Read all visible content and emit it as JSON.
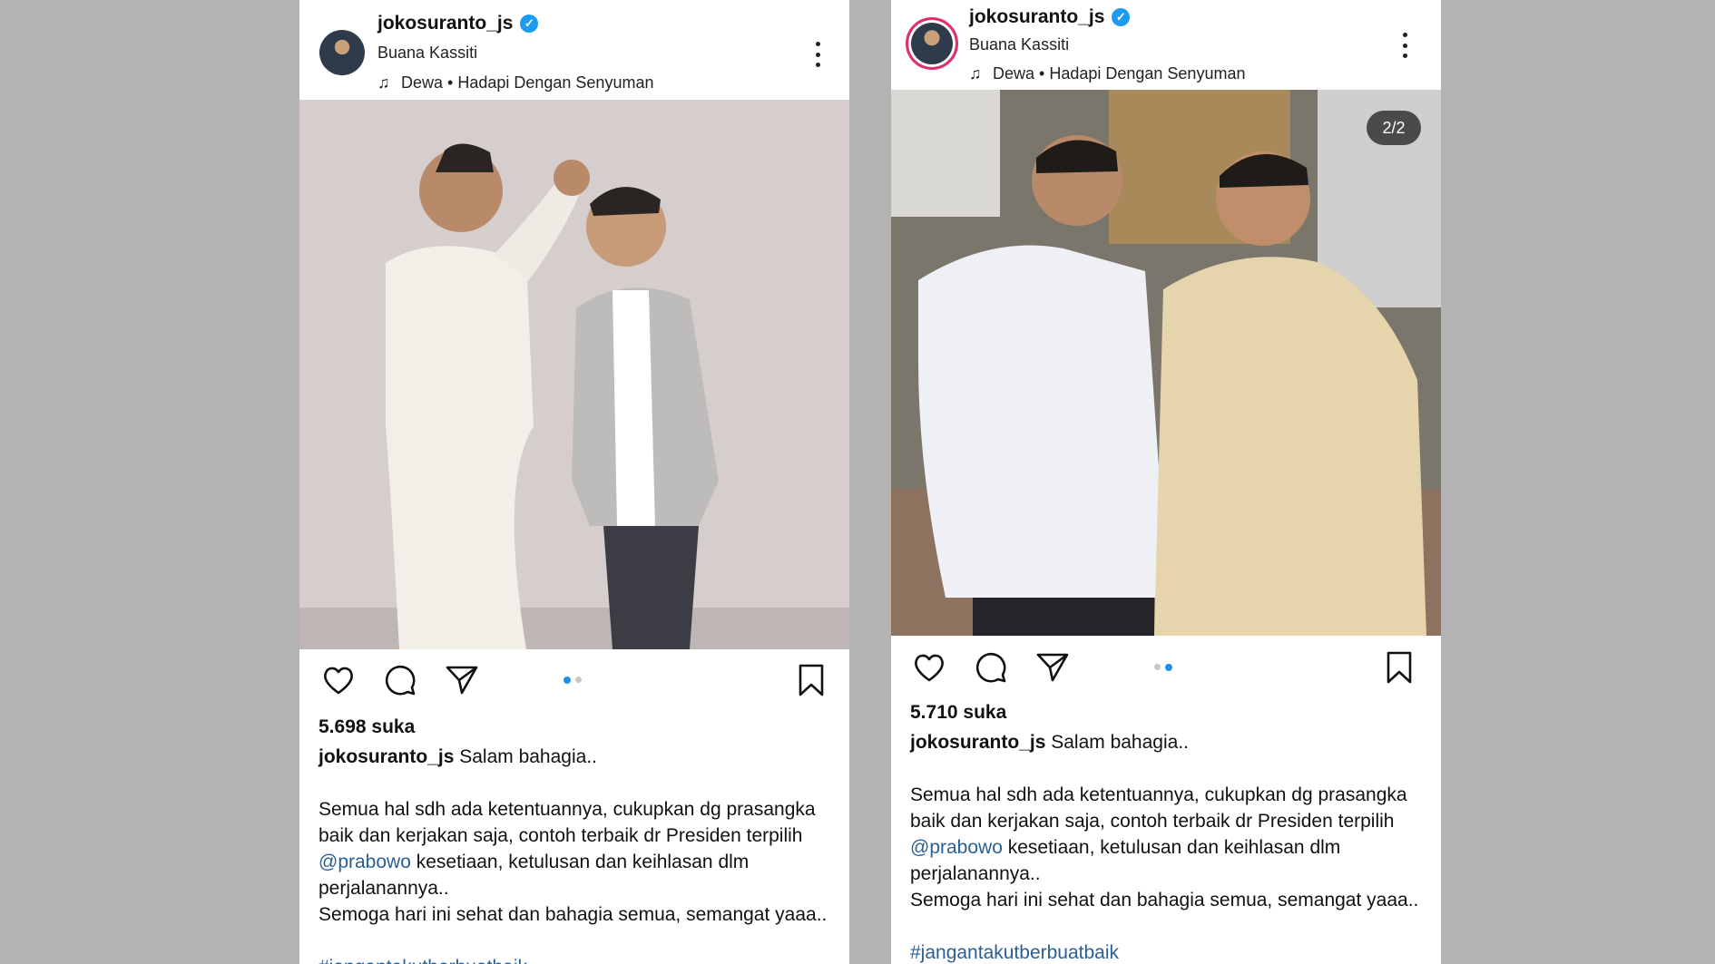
{
  "posts": [
    {
      "username": "jokosuranto_js",
      "location": "Buana Kassiti",
      "music": "Dewa • Hadapi Dengan Senyuman",
      "likes": "5.698 suka",
      "caption_user": "jokosuranto_js",
      "caption_first": "Salam bahagia..",
      "body1": "Semua hal sdh ada ketentuannya, cukupkan dg prasangka baik dan kerjakan saja, contoh terbaik dr Presiden terpilih",
      "mention": "@prabowo",
      "body2": "kesetiaan, ketulusan dan keihlasan dlm perjalanannya..",
      "body3": "Semoga hari ini sehat dan bahagia semua, semangat yaaa..",
      "hashtag": "#jangantakutberbuatbaik",
      "carousel_active": 1
    },
    {
      "username": "jokosuranto_js",
      "location": "Buana Kassiti",
      "music": "Dewa • Hadapi Dengan Senyuman",
      "counter": "2/2",
      "likes": "5.710 suka",
      "caption_user": "jokosuranto_js",
      "caption_first": "Salam bahagia..",
      "body1": "Semua hal sdh ada ketentuannya, cukupkan dg prasangka baik dan kerjakan saja, contoh terbaik dr Presiden terpilih",
      "mention": "@prabowo",
      "body2": "kesetiaan, ketulusan dan keihlasan dlm perjalanannya..",
      "body3": "Semoga hari ini sehat dan bahagia semua, semangat yaaa..",
      "hashtag": "#jangantakutberbuatbaik",
      "carousel_active": 2
    }
  ],
  "icons": {
    "verified": "verified-badge-icon",
    "music": "music-note-icon",
    "more": "more-options-icon",
    "like": "heart-icon",
    "comment": "comment-icon",
    "share": "send-icon",
    "save": "bookmark-icon"
  },
  "colors": {
    "verified": "#1d9bf0",
    "link": "#2a5f95",
    "carousel_active": "#1d8ff0",
    "story_ring": "#e1306c"
  }
}
